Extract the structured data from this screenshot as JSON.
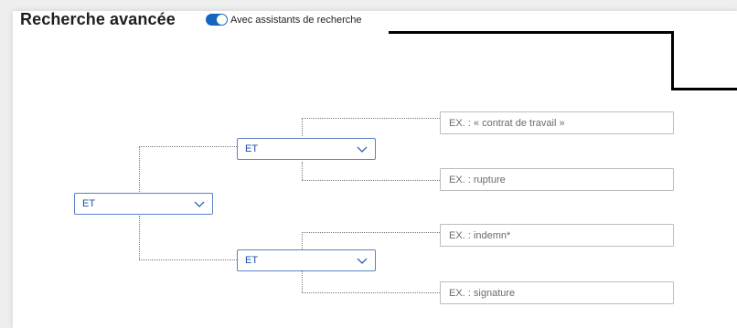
{
  "header": {
    "title": "Recherche avancée",
    "assist_toggle": {
      "label": "Avec assistants de recherche",
      "on": true,
      "color": "#1565c0"
    }
  },
  "operators": {
    "root": "ET",
    "top": "ET",
    "bottom": "ET"
  },
  "fields": [
    {
      "placeholder": "EX. : « contrat de travail »"
    },
    {
      "placeholder": "EX. : rupture"
    },
    {
      "placeholder": "EX. : indemn*"
    },
    {
      "placeholder": "EX. : signature"
    }
  ],
  "colors": {
    "accent": "#1565c0",
    "select_border": "#5b82c5",
    "select_text": "#1c4ea8"
  }
}
